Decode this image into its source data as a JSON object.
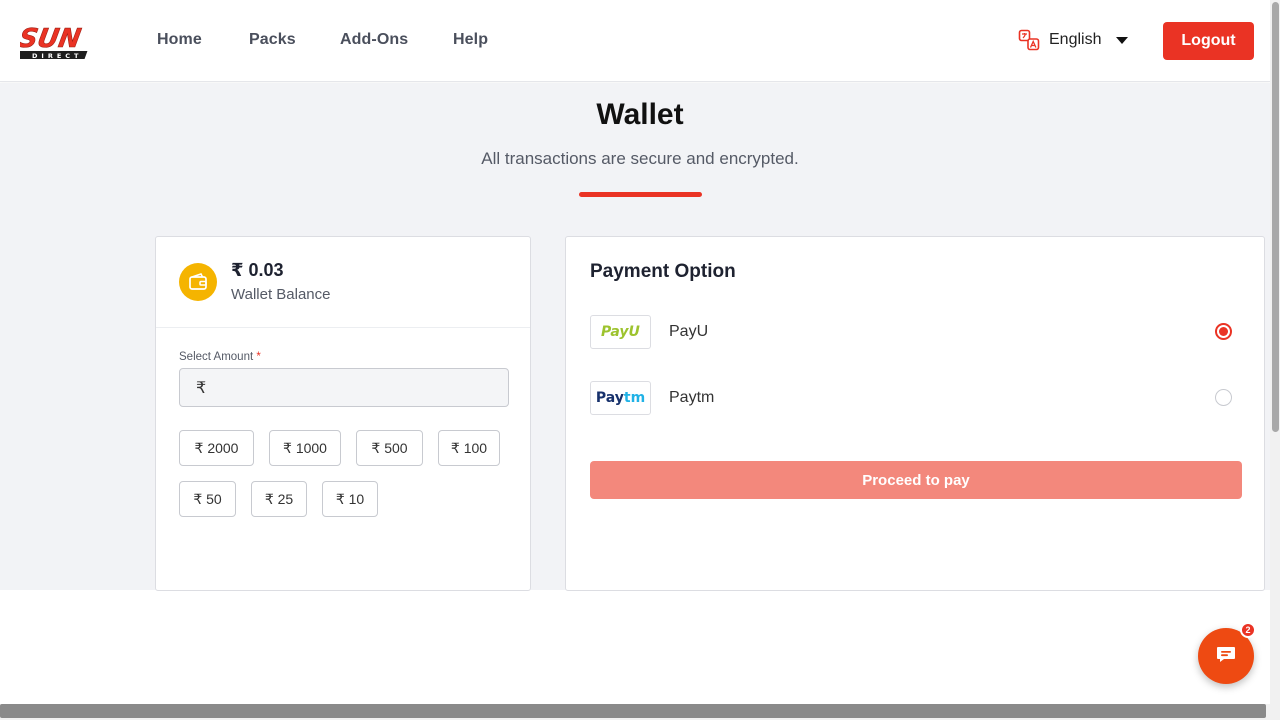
{
  "header": {
    "logo": {
      "text_main": "SUN",
      "text_sub": "DIRECT"
    },
    "nav": [
      {
        "label": "Home"
      },
      {
        "label": "Packs"
      },
      {
        "label": "Add-Ons"
      },
      {
        "label": "Help"
      }
    ],
    "language": {
      "label": "English",
      "icon": "translate-icon"
    },
    "logout_label": "Logout"
  },
  "page": {
    "title": "Wallet",
    "subtitle": "All transactions are secure and encrypted."
  },
  "wallet": {
    "balance": "₹ 0.03",
    "balance_label": "Wallet Balance",
    "icon": "wallet-icon",
    "select_amount_label": "Select Amount",
    "required_marker": "*",
    "currency_symbol": "₹",
    "amount_value": "",
    "amount_chips": [
      {
        "label": "₹ 2000"
      },
      {
        "label": "₹ 1000"
      },
      {
        "label": "₹ 500"
      },
      {
        "label": "₹ 100"
      },
      {
        "label": "₹ 50"
      },
      {
        "label": "₹ 25"
      },
      {
        "label": "₹ 10"
      }
    ]
  },
  "payment": {
    "title": "Payment Option",
    "options": [
      {
        "name": "PayU",
        "logo_text": "PayU",
        "selected": true
      },
      {
        "name": "Paytm",
        "logo_text_1": "Pay",
        "logo_text_2": "tm",
        "selected": false
      }
    ],
    "proceed_label": "Proceed to pay"
  },
  "chat": {
    "badge_count": "2",
    "icon": "chat-icon"
  },
  "colors": {
    "accent": "#ea3324",
    "proceed_disabled": "#f3887c",
    "wallet_icon_bg": "#f5b400",
    "chat_bg": "#ee4a12",
    "band_bg": "#f2f3f6"
  }
}
